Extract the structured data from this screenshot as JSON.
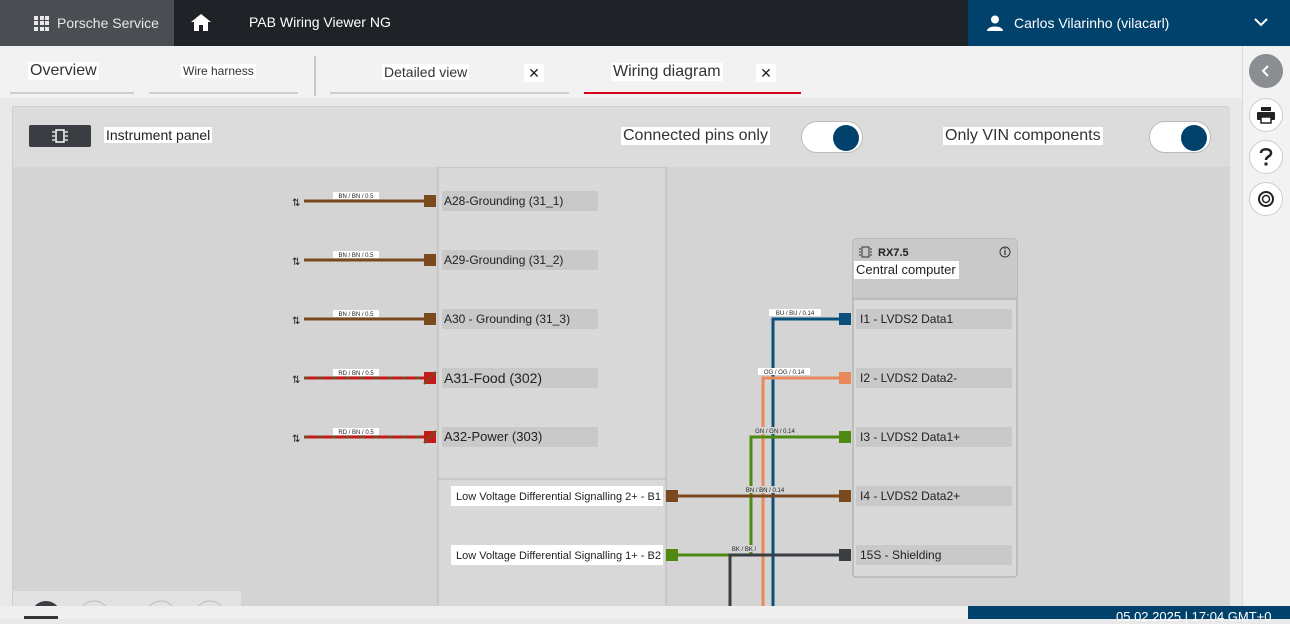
{
  "header": {
    "brand_label": "Porsche Service",
    "app_title": "PAB Wiring Viewer NG",
    "user_name": "Carlos Vilarinho (vilacarl)"
  },
  "tabs": [
    {
      "label": "Overview"
    },
    {
      "label": "Wire harness"
    },
    {
      "label": "Detailed view",
      "close": "✕"
    },
    {
      "label": "Wiring diagram",
      "close": "✕"
    }
  ],
  "panel": {
    "component_label": "Instrument panel",
    "toggle_connected": "Connected pins only",
    "toggle_vin": "Only VIN components"
  },
  "diagram": {
    "left_pins": [
      {
        "label": "A28-Grounding (31_1)",
        "wire": "BN / BN / 0.5",
        "color": "#7a4a1e"
      },
      {
        "label": "A29-Grounding (31_2)",
        "wire": "BN / BN / 0.5",
        "color": "#7a4a1e"
      },
      {
        "label": "A30 - Grounding (31_3)",
        "wire": "BN / BN / 0.5",
        "color": "#7a4a1e"
      },
      {
        "label": "A31-Food (302)",
        "wire": "RD / BN / 0.5",
        "color": "#c41a1a"
      },
      {
        "label": "A32-Power (303)",
        "wire": "RD / BN / 0.5",
        "color": "#c41a1a"
      }
    ],
    "mid_pins": [
      {
        "label": "Low Voltage Differential Signalling 2+ - B1",
        "color": "#7a4a1e"
      },
      {
        "label": "Low Voltage Differential Signalling 1+ - B2",
        "color": "#4e8a12"
      }
    ],
    "component": {
      "id": "RX7.5",
      "name": "Central computer",
      "pins": [
        {
          "label": "I1 - LVDS2 Data1",
          "wire": "BU / BU / 0.14",
          "color": "#0b4f7c"
        },
        {
          "label": "I2 - LVDS2 Data2-",
          "wire": "OG / OG / 0.14",
          "color": "#e8895a"
        },
        {
          "label": "I3 - LVDS2 Data1+",
          "wire": "GN / GN / 0.14",
          "color": "#4e8a12"
        },
        {
          "label": "I4 - LVDS2 Data2+",
          "wire": "BN / BN / 0.14",
          "color": "#7a4a1e"
        },
        {
          "label": "15S - Shielding",
          "wire": "BK / BK /",
          "color": "#3a3d42"
        }
      ]
    }
  },
  "footer": {
    "timestamp": "05.02.2025 | 17:04 GMT+0"
  },
  "colors": {
    "accent": "#00426b",
    "active_tab": "#d5001c"
  }
}
